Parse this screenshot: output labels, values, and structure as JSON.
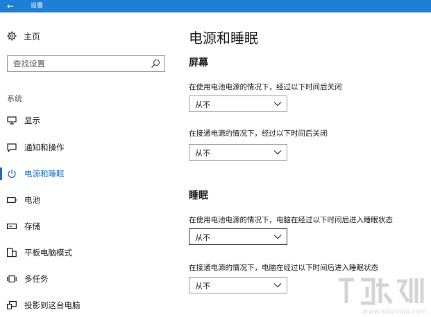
{
  "window": {
    "title": "设置"
  },
  "sidebar": {
    "home_label": "主页",
    "search_placeholder": "查找设置",
    "section_label": "系统",
    "items": [
      {
        "label": "显示",
        "icon": "monitor-icon"
      },
      {
        "label": "通知和操作",
        "icon": "notification-icon"
      },
      {
        "label": "电源和睡眠",
        "icon": "power-icon",
        "active": true
      },
      {
        "label": "电池",
        "icon": "battery-icon"
      },
      {
        "label": "存储",
        "icon": "storage-icon"
      },
      {
        "label": "平板电脑模式",
        "icon": "tablet-mode-icon"
      },
      {
        "label": "多任务",
        "icon": "multitask-icon"
      },
      {
        "label": "投影到这台电脑",
        "icon": "project-icon"
      }
    ]
  },
  "main": {
    "page_title": "电源和睡眠",
    "screen": {
      "title": "屏幕",
      "battery_label": "在使用电池电源的情况下，经过以下时间后关闭",
      "battery_value": "从不",
      "plugged_label": "在接通电源的情况下，经过以下时间后关闭",
      "plugged_value": "从不"
    },
    "sleep": {
      "title": "睡眠",
      "battery_label": "在使用电池电源的情况下，电脑在经过以下时间后进入睡眠状态",
      "battery_value": "从不",
      "plugged_label": "在接通电源的情况下，电脑在经过以下时间后进入睡眠状态",
      "plugged_value": "从不"
    }
  },
  "watermark": {
    "text": "www.xiazaiba.com"
  },
  "colors": {
    "titlebar": "#1e7fd6",
    "accent": "#1e6fc4"
  }
}
